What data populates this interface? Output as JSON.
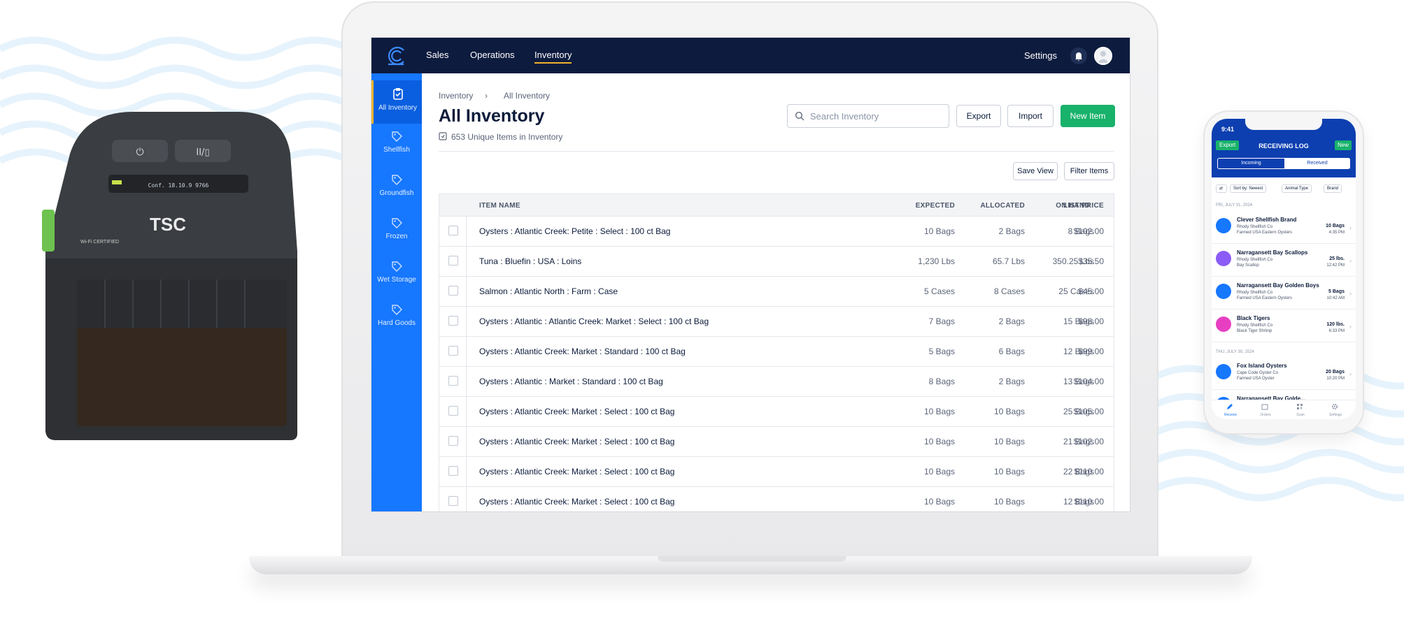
{
  "colors": {
    "navy": "#0d1b3e",
    "sidebar_blue": "#1677ff",
    "accent_green": "#18b26b",
    "active_underline": "#f0b429"
  },
  "printer": {
    "brand": "TSC",
    "badge": "Wi-Fi CERTIFIED",
    "display": "Conf. 18.10.9 9766"
  },
  "app": {
    "nav": {
      "sales": "Sales",
      "operations": "Operations",
      "inventory": "Inventory",
      "settings": "Settings"
    },
    "sidebar": [
      {
        "label": "All Inventory",
        "icon": "clipboard-check-icon"
      },
      {
        "label": "Shellfish",
        "icon": "tag-icon"
      },
      {
        "label": "Groundfish",
        "icon": "tag-icon"
      },
      {
        "label": "Frozen",
        "icon": "tag-icon"
      },
      {
        "label": "Wet Storage",
        "icon": "tag-icon"
      },
      {
        "label": "Hard Goods",
        "icon": "tag-icon"
      }
    ],
    "breadcrumb": {
      "root": "Inventory",
      "current": "All Inventory"
    },
    "title": "All Inventory",
    "subtitle": "653 Unique Items in Inventory",
    "search_placeholder": "Search Inventory",
    "buttons": {
      "export": "Export",
      "import": "Import",
      "new_item": "New Item",
      "save_view": "Save View",
      "filter_items": "Filter Items"
    },
    "columns": {
      "name": "ITEM  NAME",
      "expected": "EXPECTED",
      "allocated": "ALLOCATED",
      "on_hand": "ON HAND",
      "list_price": "LIST PRICE"
    },
    "rows": [
      {
        "name": "Oysters : Atlantic Creek: Petite : Select : 100 ct Bag",
        "expected": "10 Bags",
        "allocated": "2 Bags",
        "on_hand": "8 Bags",
        "price": "$102.00"
      },
      {
        "name": "Tuna : Bluefin : USA : Loins",
        "expected": "1,230 Lbs",
        "allocated": "65.7 Lbs",
        "on_hand": "350.25 Lbs",
        "price": "$35.50"
      },
      {
        "name": "Salmon : Atlantic North : Farm : Case",
        "expected": "5 Cases",
        "allocated": "8 Cases",
        "on_hand": "25 Cases",
        "price": "$45.00"
      },
      {
        "name": "Oysters : Atlantic : Atlantic Creek: Market : Select : 100 ct Bag",
        "expected": "7 Bags",
        "allocated": "2 Bags",
        "on_hand": "15 Bags",
        "price": "$98.00"
      },
      {
        "name": "Oysters : Atlantic Creek: Market : Standard : 100 ct Bag",
        "expected": "5 Bags",
        "allocated": "6 Bags",
        "on_hand": "12 Bags",
        "price": "$99.00"
      },
      {
        "name": "Oysters : Atlantic : Market : Standard : 100 ct Bag",
        "expected": "8 Bags",
        "allocated": "2 Bags",
        "on_hand": "13 Bags",
        "price": "$104.00"
      },
      {
        "name": "Oysters : Atlantic Creek: Market : Select : 100 ct Bag",
        "expected": "10 Bags",
        "allocated": "10 Bags",
        "on_hand": "25 Bags",
        "price": "$105.00"
      },
      {
        "name": "Oysters : Atlantic Creek: Market : Select : 100 ct Bag",
        "expected": "10 Bags",
        "allocated": "10 Bags",
        "on_hand": "21 Bags",
        "price": "$102.00"
      },
      {
        "name": "Oysters : Atlantic Creek: Market : Select : 100 ct Bag",
        "expected": "10 Bags",
        "allocated": "10 Bags",
        "on_hand": "22 Bags",
        "price": "$110.00"
      },
      {
        "name": "Oysters : Atlantic Creek: Market : Select : 100 ct Bag",
        "expected": "10 Bags",
        "allocated": "10 Bags",
        "on_hand": "12 Bags",
        "price": "$110.00"
      }
    ]
  },
  "phone": {
    "time": "9:41",
    "title": "RECEIVING LOG",
    "export": "Export",
    "new": "New",
    "seg_incoming": "Incoming",
    "seg_received": "Received",
    "filters": [
      "Sort by: Newest",
      "Animal Type",
      "Brand"
    ],
    "date1": "FRI, JULY 31, 2024",
    "date2": "THU, JULY 30, 2024",
    "items": [
      {
        "name": "Clever Shellfish Brand",
        "s1": "Rhody Shellfish Co",
        "s2": "Farmed USA Eastern Oysters",
        "qty": "10 Bags",
        "time": "4:35 PM",
        "color": "#1677ff"
      },
      {
        "name": "Narragansett Bay Scallops",
        "s1": "Rhody Shellfish Co",
        "s2": "Bay Scallop",
        "qty": "25 lbs.",
        "time": "12:42 PM",
        "color": "#8b5cf6"
      },
      {
        "name": "Narragansett Bay Golden Boys",
        "s1": "Rhody Shellfish Co",
        "s2": "Farmed USA Eastern Oysters",
        "qty": "5 Bags",
        "time": "10:42 AM",
        "color": "#1677ff"
      },
      {
        "name": "Black Tigers",
        "s1": "Rhody Shellfish Co",
        "s2": "Black Tiger Shrimp",
        "qty": "120 lbs.",
        "time": "6:33 PM",
        "color": "#e83fc2"
      },
      {
        "name": "Fox Island Oysters",
        "s1": "Cape Code Oyster Co",
        "s2": "Farmed USA Oyster",
        "qty": "20 Bags",
        "time": "10:20 PM",
        "color": "#1677ff"
      },
      {
        "name": "Narragansett Bay Golde...",
        "s1": "",
        "s2": "",
        "qty": "",
        "time": "",
        "color": "#1677ff"
      }
    ],
    "tabs": [
      "Receive",
      "Orders",
      "Scan",
      "Settings"
    ]
  }
}
